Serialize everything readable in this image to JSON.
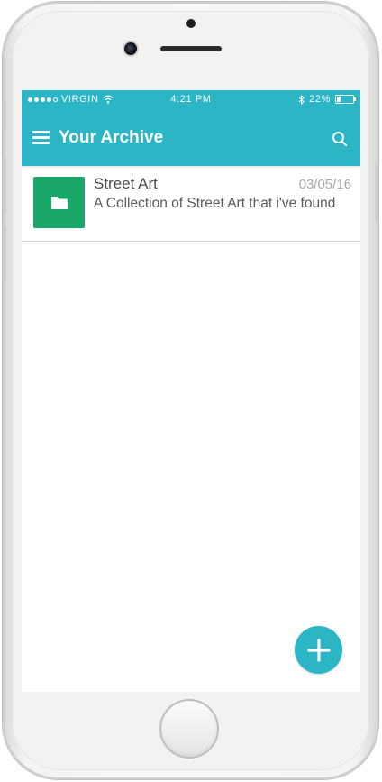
{
  "status_bar": {
    "carrier": "VIRGIN",
    "time": "4:21 PM",
    "battery": "22%",
    "battery_level": 0.22,
    "signal_bars": 4,
    "icons": [
      "signal-dots-icon",
      "wifi-icon",
      "bluetooth-icon",
      "battery-icon"
    ]
  },
  "app_bar": {
    "title": "Your Archive",
    "menu_icon": "hamburger-menu-icon",
    "search_icon": "search-icon",
    "color": "#2cb5c5"
  },
  "items": [
    {
      "title": "Street Art",
      "date": "03/05/16",
      "description": "A Collection of Street Art that i've found",
      "icon": "folder-icon",
      "icon_color": "#19a86a"
    }
  ],
  "fab": {
    "icon": "plus-icon",
    "color": "#2cb5c5"
  }
}
